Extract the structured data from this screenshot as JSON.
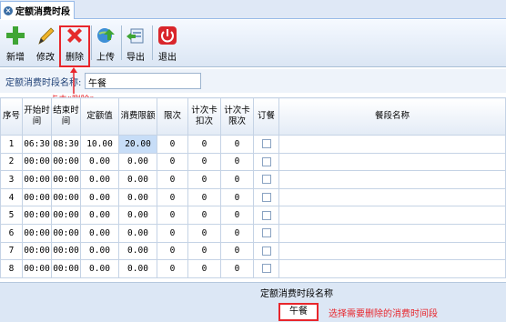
{
  "window": {
    "tab_title": "定额消费时段"
  },
  "toolbar": {
    "add": "新增",
    "edit": "修改",
    "delete": "删除",
    "upload": "上传",
    "export": "导出",
    "exit": "退出"
  },
  "form": {
    "name_label": "定额消费时段名称:",
    "name_value": "午餐"
  },
  "annotations": {
    "click_delete": "点击\"删除\"",
    "select_hint": "选择需要删除的消费时间段"
  },
  "grid": {
    "headers": {
      "seq": "序号",
      "start": "开始时间",
      "end": "结束时间",
      "amount": "定额值",
      "limit": "消费限额",
      "times": "限次",
      "card_deduct": "计次卡扣次",
      "card_limit": "计次卡限次",
      "order": "订餐",
      "name": "餐段名称"
    },
    "rows": [
      {
        "seq": "1",
        "start": "06:30",
        "end": "08:30",
        "amount": "10.00",
        "limit": "20.00",
        "times": "0",
        "deduct": "0",
        "climit": "0"
      },
      {
        "seq": "2",
        "start": "00:00",
        "end": "00:00",
        "amount": "0.00",
        "limit": "0.00",
        "times": "0",
        "deduct": "0",
        "climit": "0"
      },
      {
        "seq": "3",
        "start": "00:00",
        "end": "00:00",
        "amount": "0.00",
        "limit": "0.00",
        "times": "0",
        "deduct": "0",
        "climit": "0"
      },
      {
        "seq": "4",
        "start": "00:00",
        "end": "00:00",
        "amount": "0.00",
        "limit": "0.00",
        "times": "0",
        "deduct": "0",
        "climit": "0"
      },
      {
        "seq": "5",
        "start": "00:00",
        "end": "00:00",
        "amount": "0.00",
        "limit": "0.00",
        "times": "0",
        "deduct": "0",
        "climit": "0"
      },
      {
        "seq": "6",
        "start": "00:00",
        "end": "00:00",
        "amount": "0.00",
        "limit": "0.00",
        "times": "0",
        "deduct": "0",
        "climit": "0"
      },
      {
        "seq": "7",
        "start": "00:00",
        "end": "00:00",
        "amount": "0.00",
        "limit": "0.00",
        "times": "0",
        "deduct": "0",
        "climit": "0"
      },
      {
        "seq": "8",
        "start": "00:00",
        "end": "00:00",
        "amount": "0.00",
        "limit": "0.00",
        "times": "0",
        "deduct": "0",
        "climit": "0"
      }
    ]
  },
  "footer": {
    "caption": "定额消费时段名称",
    "selected": "午餐"
  },
  "colors": {
    "accent_red": "#e8262c",
    "grid_border": "#c5d3e5",
    "panel": "#dce7f5"
  }
}
